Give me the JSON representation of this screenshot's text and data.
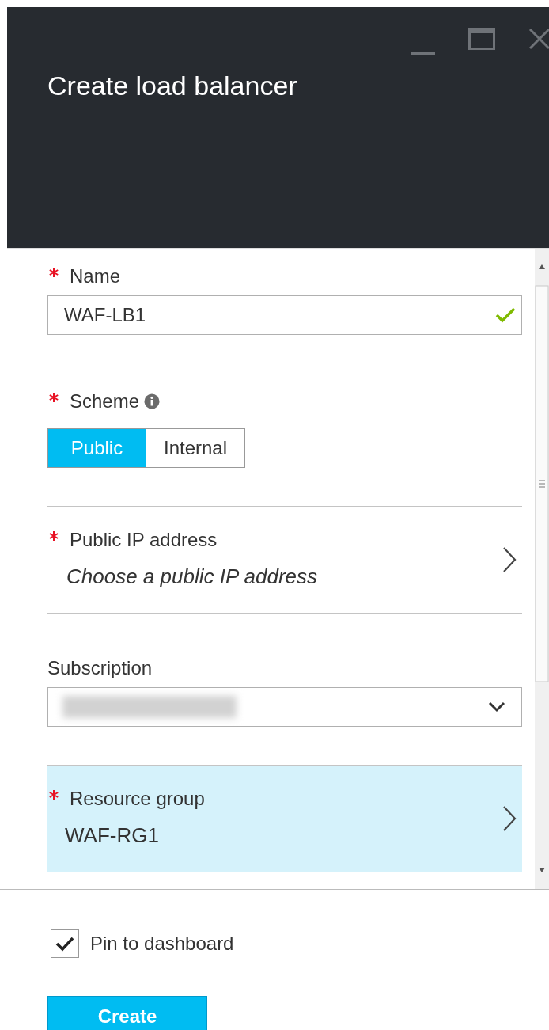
{
  "window": {
    "title": "Create load balancer"
  },
  "form": [
    {
      "kind": "text",
      "label": "Name",
      "required": true,
      "value": "WAF-LB1",
      "valid": true
    },
    {
      "kind": "toggle",
      "label": "Scheme",
      "required": true,
      "info": true,
      "options": [
        {
          "label": "Public",
          "selected": true
        },
        {
          "label": "Internal",
          "selected": false
        }
      ]
    },
    {
      "kind": "picker",
      "label": "Public IP address",
      "required": true,
      "placeholder": "Choose a public IP address",
      "highlighted": false
    },
    {
      "kind": "dropdown",
      "label": "Subscription",
      "required": false,
      "redacted": true
    },
    {
      "kind": "picker",
      "label": "Resource group",
      "required": true,
      "value": "WAF-RG1",
      "highlighted": true
    }
  ],
  "footer": {
    "pin": {
      "label": "Pin to dashboard",
      "checked": true
    },
    "button": "Create"
  }
}
